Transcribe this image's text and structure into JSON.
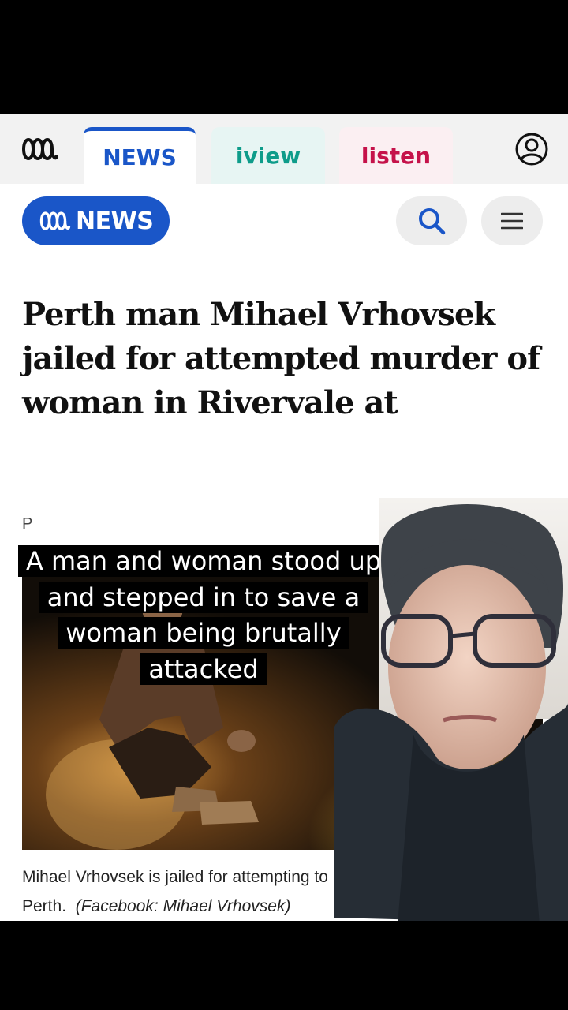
{
  "network_bar": {
    "tabs": [
      {
        "label": "NEWS",
        "active": true
      },
      {
        "label": "iview",
        "active": false
      },
      {
        "label": "listen",
        "active": false
      }
    ]
  },
  "header": {
    "news_badge_label": "NEWS",
    "search_icon": "search-icon",
    "menu_icon": "hamburger-menu-icon"
  },
  "article": {
    "headline": "Perth man Mihael Vrhovsek jailed for attempted murder of woman in Rivervale at",
    "byline_fragment": "P",
    "caption": "Mihael Vrhovsek is jailed for attempting to murder a woman in suburban Perth.",
    "credit": "(Facebook: Mihael Vrhovsek)"
  },
  "overlay": {
    "subtitle": "A man and woman stood up and stepped in to save a woman being brutally attacked"
  },
  "colors": {
    "news_blue": "#1a56c8",
    "iview_teal": "#0e9c8a",
    "listen_red": "#c5124a"
  }
}
